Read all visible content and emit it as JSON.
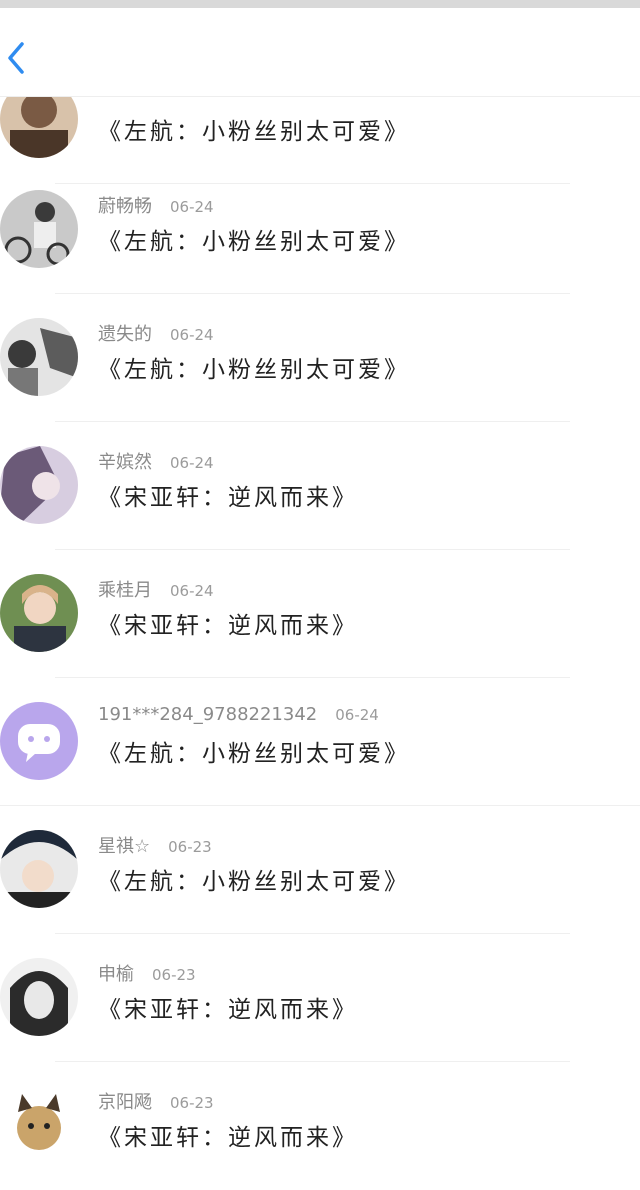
{
  "nav": {
    "back_icon": "chevron-left-icon",
    "accent": "#2f8cf0"
  },
  "comments": [
    {
      "name": "",
      "date": "",
      "text": "《左航：小粉丝别太可爱》",
      "avatar_color": "#7a5a44"
    },
    {
      "name": "蔚畅畅",
      "date": "06-24",
      "text": "《左航：小粉丝别太可爱》",
      "avatar_color": "#3a3a3a"
    },
    {
      "name": "遗失的",
      "date": "06-24",
      "text": "《左航：小粉丝别太可爱》",
      "avatar_color": "#5c5c5c"
    },
    {
      "name": "辛嫔然",
      "date": "06-24",
      "text": "《宋亚轩：逆风而来》",
      "avatar_color": "#6b5a78"
    },
    {
      "name": "乘桂月",
      "date": "06-24",
      "text": "《宋亚轩：逆风而来》",
      "avatar_color": "#4e6a3c"
    },
    {
      "name": "191***284_9788221342",
      "date": "06-24",
      "text": "《左航：小粉丝别太可爱》",
      "avatar_color": "#b9a6ec"
    },
    {
      "name": "星祺☆",
      "date": "06-23",
      "text": "《左航：小粉丝别太可爱》",
      "avatar_color": "#1f2a3a"
    },
    {
      "name": "申榆",
      "date": "06-23",
      "text": "《宋亚轩：逆风而来》",
      "avatar_color": "#2b2b2b"
    },
    {
      "name": "京阳飏",
      "date": "06-23",
      "text": "《宋亚轩：逆风而来》",
      "avatar_color": "#caa46a"
    }
  ]
}
